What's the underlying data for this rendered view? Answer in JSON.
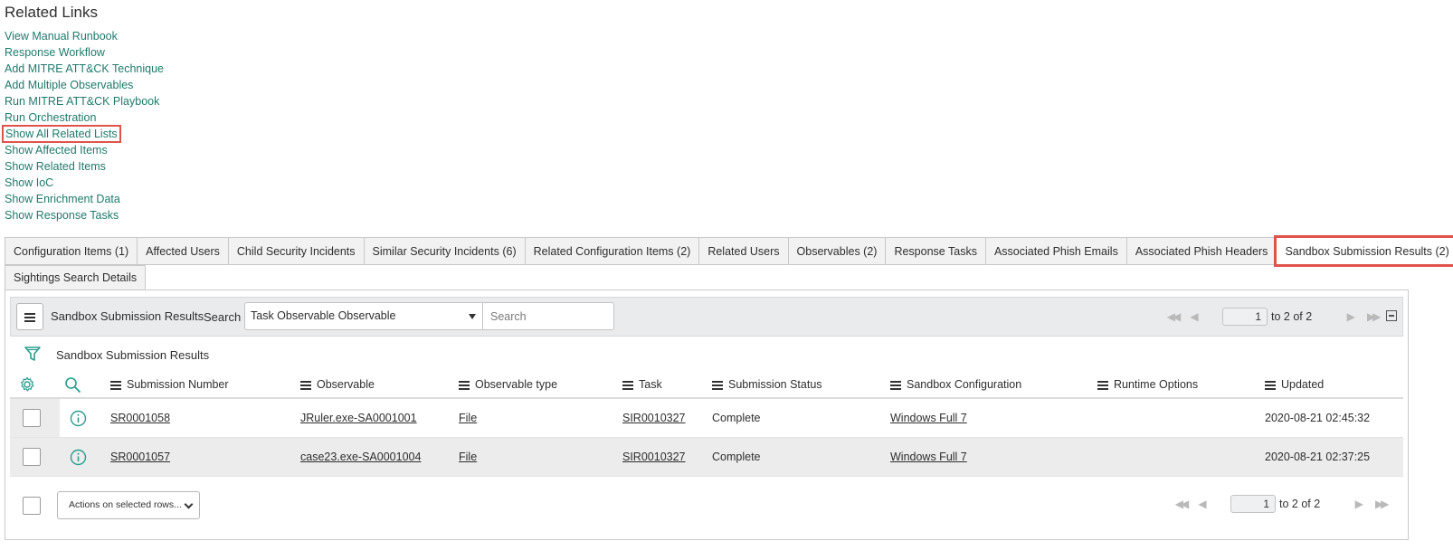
{
  "related_links": {
    "title": "Related Links",
    "items": [
      {
        "label": "View Manual Runbook"
      },
      {
        "label": "Response Workflow"
      },
      {
        "label": "Add MITRE ATT&CK Technique"
      },
      {
        "label": "Add Multiple Observables"
      },
      {
        "label": "Run MITRE ATT&CK Playbook"
      },
      {
        "label": "Run Orchestration"
      },
      {
        "label": "Show All Related Lists"
      },
      {
        "label": "Show Affected Items"
      },
      {
        "label": "Show Related Items"
      },
      {
        "label": "Show IoC"
      },
      {
        "label": "Show Enrichment Data"
      },
      {
        "label": "Show Response Tasks"
      }
    ]
  },
  "tabs": {
    "row1": [
      {
        "label": "Configuration Items (1)"
      },
      {
        "label": "Affected Users"
      },
      {
        "label": "Child Security Incidents"
      },
      {
        "label": "Similar Security Incidents (6)"
      },
      {
        "label": "Related Configuration Items (2)"
      },
      {
        "label": "Related Users"
      },
      {
        "label": "Observables (2)"
      },
      {
        "label": "Response Tasks"
      },
      {
        "label": "Associated Phish Emails"
      },
      {
        "label": "Associated Phish Headers"
      },
      {
        "label": "Sandbox Submission Results (2)"
      }
    ],
    "row2": [
      {
        "label": "Sightings Search Details"
      }
    ]
  },
  "toolbar": {
    "title": "Sandbox Submission Results",
    "search_label": "Search",
    "search_field": "Task Observable Observable",
    "search_placeholder": "Search",
    "page_value": "1",
    "page_total": "to 2 of 2"
  },
  "filter": {
    "label": "Sandbox Submission Results"
  },
  "table": {
    "columns": [
      "Submission Number",
      "Observable",
      "Observable type",
      "Task",
      "Submission Status",
      "Sandbox Configuration",
      "Runtime Options",
      "Updated"
    ],
    "rows": [
      {
        "number": "SR0001058",
        "observable": "JRuler.exe-SA0001001",
        "type": "File",
        "task": "SIR0010327",
        "status": "Complete",
        "config": "Windows Full 7",
        "runtime": "",
        "updated": "2020-08-21 02:45:32"
      },
      {
        "number": "SR0001057",
        "observable": "case23.exe-SA0001004",
        "type": "File",
        "task": "SIR0010327",
        "status": "Complete",
        "config": "Windows Full 7",
        "runtime": "",
        "updated": "2020-08-21 02:37:25"
      }
    ]
  },
  "footer": {
    "actions_label": "Actions on selected rows...",
    "page_value": "1",
    "page_total": "to 2 of 2"
  },
  "colors": {
    "link": "#1f7a6d",
    "highlight": "#e0534a",
    "icon_accent": "#2a9d8f"
  }
}
